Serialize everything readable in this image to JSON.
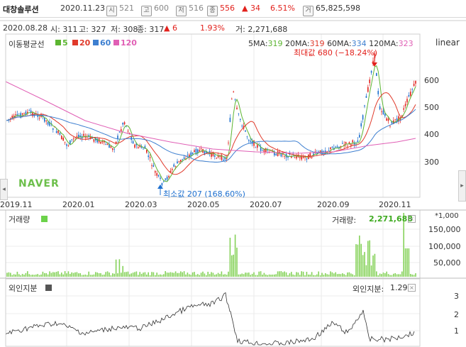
{
  "header": {
    "stock_name": "대창솔루션",
    "date": "2020.11.23",
    "open_label": "시",
    "open_value": "521",
    "high_label": "고",
    "high_value": "600",
    "low_label": "저",
    "low_value": "516",
    "close_label": "종",
    "close_value": "556",
    "change_value": "▲ 34",
    "change_pct": "6.51%",
    "volume_label": "거",
    "volume_value": "65,825,598"
  },
  "info": {
    "date": "2020.08.28",
    "open": "시: 311",
    "high": "고: 327",
    "low": "저: 308",
    "close": "종: 317",
    "change": "▲ 6",
    "change_pct": "1.93%",
    "volume": "거: 2,271,688"
  },
  "price_panel": {
    "ma_label": "이동평균선",
    "ma_legend": [
      "5",
      "20",
      "60",
      "120"
    ],
    "ma_values_labels": [
      "5MA:",
      "20MA:",
      "60MA:",
      "120MA:"
    ],
    "ma_values": [
      "319",
      "319",
      "334",
      "323"
    ],
    "scale_mode": "linear",
    "y_ticks": [
      "600",
      "500",
      "400",
      "300"
    ],
    "max_annotation": "최대값 680 (−18.24%)",
    "min_annotation": "최소값 207 (168.60%)",
    "watermark": "NAVER",
    "x_ticks": [
      "2019.11",
      "2020.01",
      "2020.03",
      "2020.05",
      "2020.07",
      "2020.09",
      "2020.11"
    ]
  },
  "volume_panel": {
    "title": "거래량",
    "value_label": "거래량:",
    "value": "2,271,688",
    "unit": "*1,000",
    "y_ticks": [
      "150,000",
      "100,000",
      "50,000"
    ]
  },
  "foreign_panel": {
    "title": "외인지분",
    "value_label": "외인지분:",
    "value": "1.29",
    "y_ticks": [
      "3",
      "2",
      "1"
    ]
  },
  "colors": {
    "ma5": "#5cb531",
    "ma20": "#e03a2b",
    "ma60": "#3d7fd0",
    "ma120": "#e05fb5",
    "up": "#e2211c",
    "down": "#1c6fcf",
    "volume": "#86d25a"
  },
  "nav": {
    "left_arrow": "◂",
    "right_arrow": "▸",
    "close_glyph": "×"
  }
}
